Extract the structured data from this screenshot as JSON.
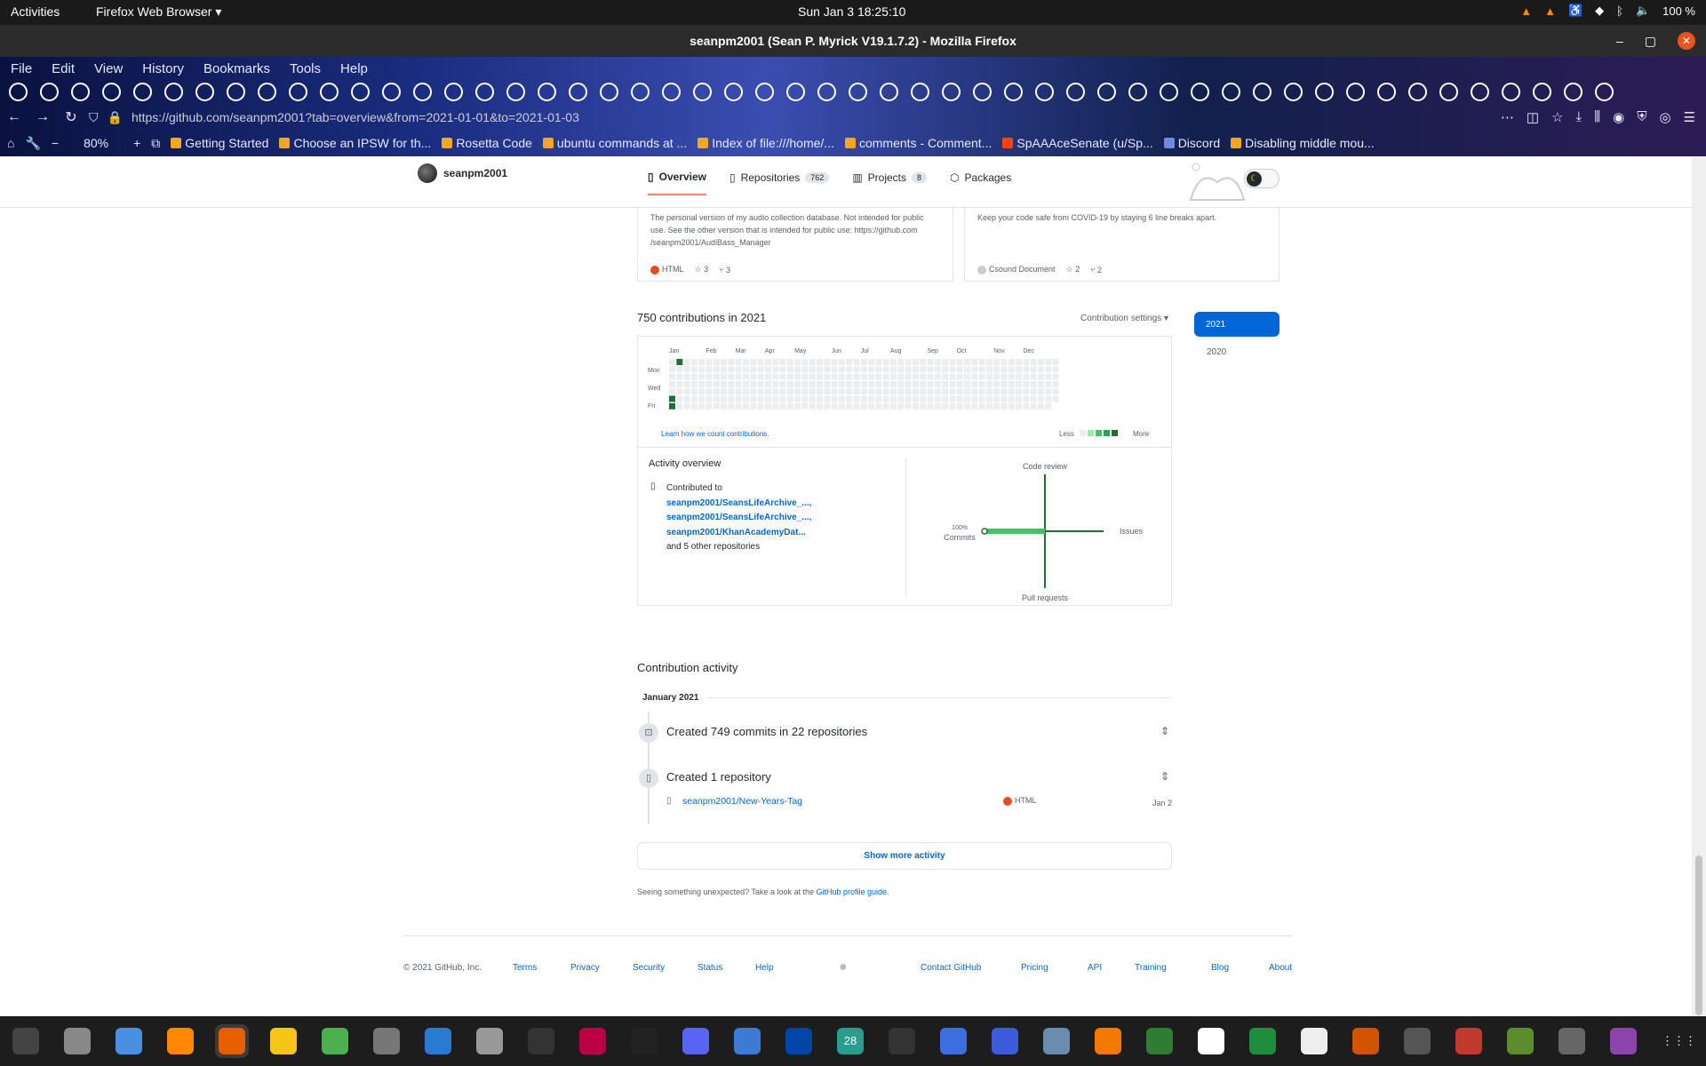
{
  "system": {
    "activities": "Activities",
    "app_menu": "Firefox Web Browser ▾",
    "clock": "Sun Jan 3  18:25:10",
    "battery": "100 %"
  },
  "window": {
    "title": "seanpm2001 (Sean P. Myrick V19.1.7.2) - Mozilla Firefox"
  },
  "menus": [
    "File",
    "Edit",
    "View",
    "History",
    "Bookmarks",
    "Tools",
    "Help"
  ],
  "navbar": {
    "url": "https://github.com/seanpm2001?tab=overview&from=2021-01-01&to=2021-01-03",
    "zoom": "80%"
  },
  "bookmarks": [
    "Getting Started",
    "Choose an IPSW for th...",
    "Rosetta Code",
    "ubuntu commands at ...",
    "Index of file:///home/...",
    "comments - Comment...",
    "SpAAAceSenate (u/Sp...",
    "Discord",
    "Disabling middle mou..."
  ],
  "profile": {
    "username": "seanpm2001",
    "tabs": [
      {
        "label": "Overview",
        "count": ""
      },
      {
        "label": "Repositories",
        "count": "762"
      },
      {
        "label": "Projects",
        "count": "8"
      },
      {
        "label": "Packages",
        "count": ""
      }
    ]
  },
  "pins": [
    {
      "desc": "The personal version of my audio collection database. Not intended for public use. See the other version that is intended for public use: https://github.com /seanpm2001/AudiBass_Manager",
      "lang": "HTML",
      "lang_color": "#e34c26",
      "stars": "3",
      "forks": "3"
    },
    {
      "desc": "Keep your code safe from COVID-19 by staying 6 line breaks apart.",
      "lang": "Csound Document",
      "lang_color": "#cccccc",
      "stars": "2",
      "forks": "2"
    }
  ],
  "contributions": {
    "title": "750 contributions in 2021",
    "settings": "Contribution settings ▾",
    "months": [
      "Jan",
      "Feb",
      "Mar",
      "Apr",
      "May",
      "Jun",
      "Jul",
      "Aug",
      "Sep",
      "Oct",
      "Nov",
      "Dec"
    ],
    "days": [
      "Mon",
      "Wed",
      "Fri"
    ],
    "learn": "Learn how we count contributions.",
    "less": "Less",
    "more": "More",
    "years": [
      "2021",
      "2020"
    ],
    "colors": [
      "#ebedf0",
      "#9be9a8",
      "#40c463",
      "#30a14e",
      "#216e39"
    ]
  },
  "activity_overview": {
    "title": "Activity overview",
    "contributed": "Contributed to",
    "repos": [
      "seanpm2001/SeansLifeArchive_...,",
      "seanpm2001/SeansLifeArchive_...,",
      "seanpm2001/KhanAcademyDat..."
    ],
    "others": "and 5 other repositories",
    "axes": {
      "top": "Code review",
      "left_pct": "100%",
      "left": "Commits",
      "right": "Issues",
      "bottom": "Pull requests"
    }
  },
  "contribution_activity": {
    "title": "Contribution activity",
    "month": "January 2021",
    "events": [
      {
        "text": "Created 749 commits in 22 repositories"
      },
      {
        "text": "Created 1 repository"
      }
    ],
    "created_repo": {
      "name": "seanpm2001/New-Years-Tag",
      "lang": "HTML",
      "date": "Jan 2"
    },
    "show_more": "Show more activity",
    "hint": "Seeing something unexpected? Take a look at the",
    "hint_link": "GitHub profile guide."
  },
  "footer": [
    "© 2021 GitHub, Inc.",
    "Terms",
    "Privacy",
    "Security",
    "Status",
    "Help",
    "Contact GitHub",
    "Pricing",
    "API",
    "Training",
    "Blog",
    "About"
  ],
  "dock_apps": [
    "system-monitor-icon",
    "files-icon",
    "text-editor-icon",
    "vlc-icon",
    "firefox-icon",
    "calculator-icon",
    "extensions-icon",
    "settings-icon",
    "writer-icon",
    "image-viewer-icon",
    "terminal-icon",
    "monitor-icon",
    "inkscape-icon",
    "discord-icon",
    "editor-icon",
    "audacity-icon",
    "calendar-icon",
    "app-icon",
    "tasks-icon",
    "screenshot-icon",
    "virtualbox-icon",
    "blender-icon",
    "gedit-icon",
    "doc-icon",
    "calc-icon",
    "typora-icon",
    "impress-icon",
    "gimp-icon",
    "game-icon",
    "minecraft-icon",
    "maps-icon",
    "tweaks-icon",
    "app-grid-icon"
  ],
  "dock_calendar": "28"
}
